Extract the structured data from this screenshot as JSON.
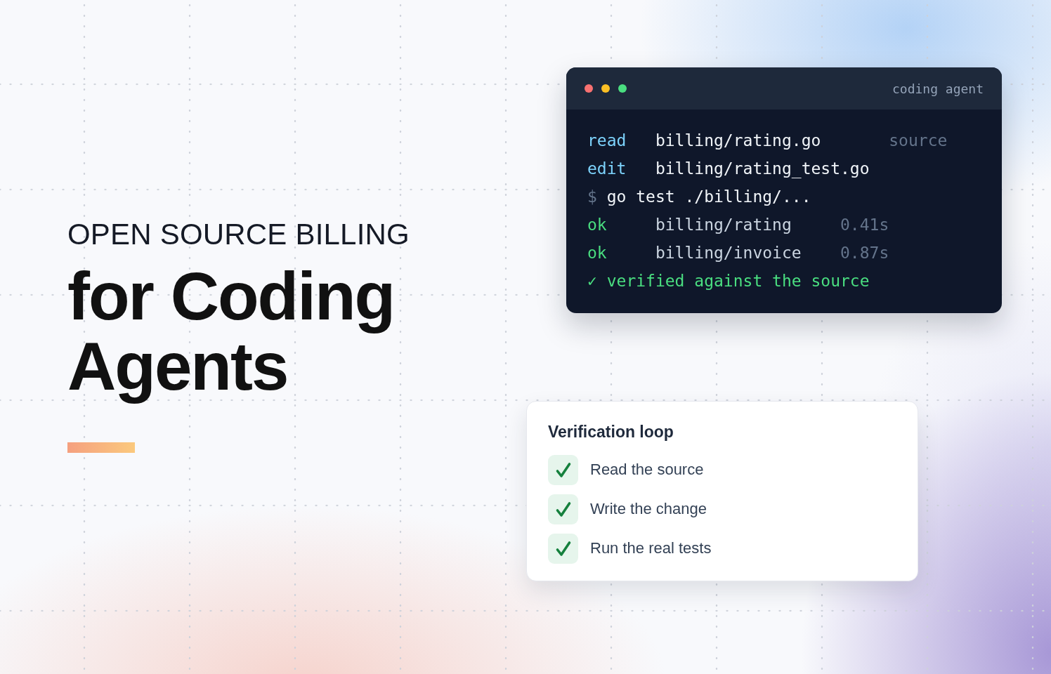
{
  "hero": {
    "eyebrow": "OPEN SOURCE BILLING",
    "title": "for Coding Agents"
  },
  "terminal": {
    "window_controls": [
      {
        "color": "#f87171"
      },
      {
        "color": "#fbbf24"
      },
      {
        "color": "#4ade80"
      }
    ],
    "title": "coding agent",
    "lines": [
      {
        "kind": "action",
        "verb": "read",
        "path": "billing/rating.go",
        "note": "source"
      },
      {
        "kind": "action",
        "verb": "edit",
        "path": "billing/rating_test.go"
      },
      {
        "kind": "command",
        "prompt": "$",
        "command": "go test ./billing/..."
      },
      {
        "kind": "result",
        "status": "ok",
        "package": "billing/rating",
        "time": "0.41s"
      },
      {
        "kind": "result",
        "status": "ok",
        "package": "billing/invoice",
        "time": "0.87s"
      },
      {
        "kind": "summary",
        "text": "✓ verified against the source"
      }
    ]
  },
  "checklist": {
    "title": "Verification loop",
    "items": [
      {
        "label": "Read the source",
        "checked": true
      },
      {
        "label": "Write the change",
        "checked": true
      },
      {
        "label": "Run the real tests",
        "checked": true
      }
    ]
  }
}
